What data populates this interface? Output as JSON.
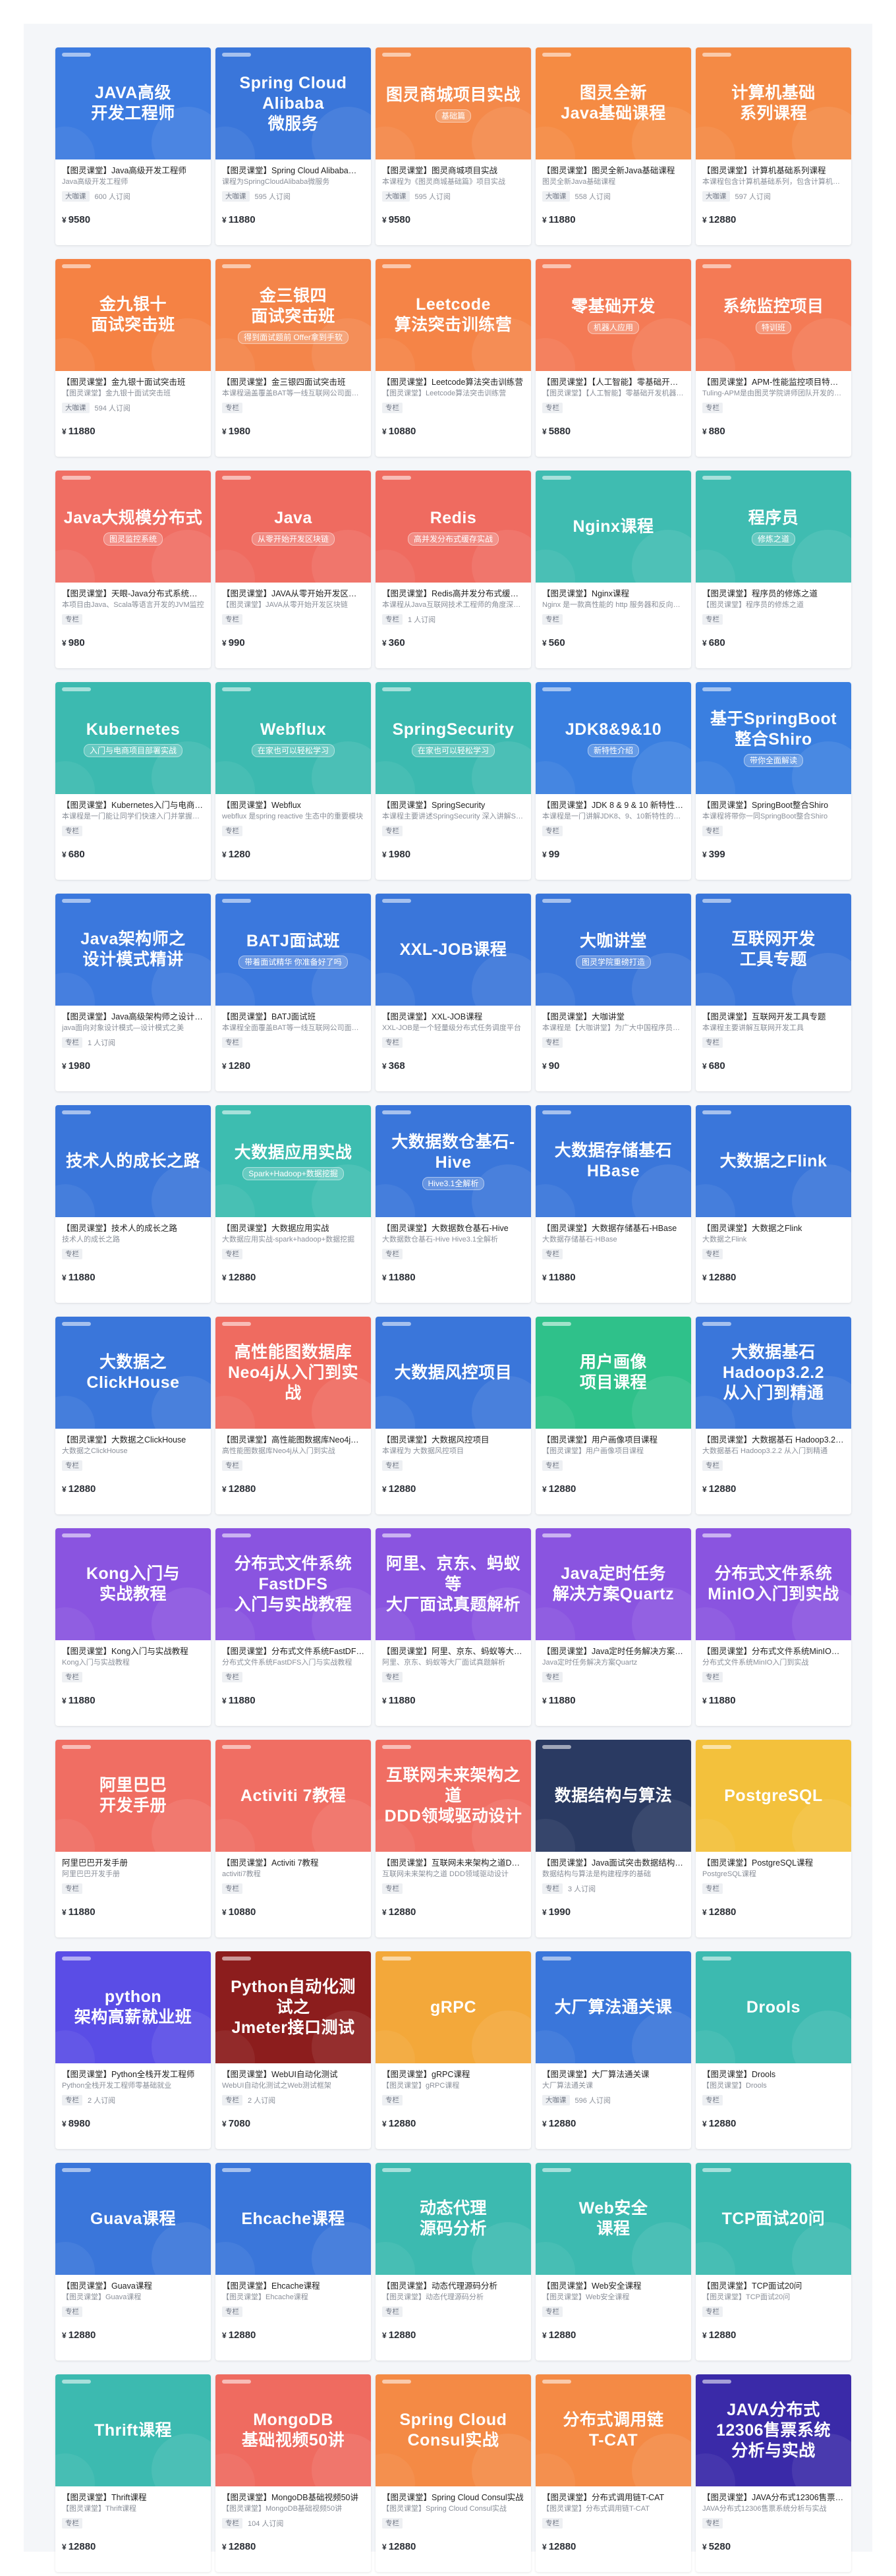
{
  "theme": {
    "price_color": "#2b2f36",
    "currency": "¥"
  },
  "courses": [
    {
      "cover_title": "JAVA高级\n开发工程师",
      "badge": "",
      "bg": "#3c7be0",
      "name": "【图灵课堂】Java高级开发工程师",
      "desc": "Java高级开发工程师",
      "tag": "大咖课",
      "enrolled": "600 人订阅",
      "price": "9580"
    },
    {
      "cover_title": "Spring Cloud Alibaba\n微服务",
      "badge": "",
      "bg": "#3a76da",
      "name": "【图灵课堂】Spring Cloud Alibaba微服务",
      "desc": "课程为SpringCloudAlibaba微服务",
      "tag": "大咖课",
      "enrolled": "595 人订阅",
      "price": "11880"
    },
    {
      "cover_title": "图灵商城项目实战",
      "badge": "基础篇",
      "bg": "#f4894a",
      "name": "【图灵课堂】图灵商城项目实战",
      "desc": "本课程为《图灵商城基础篇》项目实战",
      "tag": "大咖课",
      "enrolled": "595 人订阅",
      "price": "9580"
    },
    {
      "cover_title": "图灵全新\nJava基础课程",
      "badge": "",
      "bg": "#f58b43",
      "name": "【图灵课堂】图灵全新Java基础课程",
      "desc": "图灵全新Java基础课程",
      "tag": "大咖课",
      "enrolled": "558 人订阅",
      "price": "11880"
    },
    {
      "cover_title": "计算机基础\n系列课程",
      "badge": "",
      "bg": "#f48a45",
      "name": "【图灵课堂】计算机基础系列课程",
      "desc": "本课程包含计算机基础系列，包含计算机组成原理",
      "tag": "大咖课",
      "enrolled": "597 人订阅",
      "price": "12880"
    },
    {
      "cover_title": "金九银十\n面试突击班",
      "badge": "",
      "bg": "#f58244",
      "name": "【图灵课堂】金九银十面试突击班",
      "desc": "【图灵课堂】金九银十面试突击班",
      "tag": "大咖课",
      "enrolled": "594 人订阅",
      "price": "11880"
    },
    {
      "cover_title": "金三银四\n面试突击班",
      "badge": "得到面试题前 Offer拿到手软",
      "bg": "#f4854a",
      "name": "【图灵课堂】金三银四面试突击班",
      "desc": "本课程涵盖覆盖BAT等一线互联网公司面试题",
      "tag": "专栏",
      "enrolled": "",
      "price": "1980"
    },
    {
      "cover_title": "Leetcode\n算法突击训练营",
      "badge": "",
      "bg": "#f58447",
      "name": "【图灵课堂】Leetcode算法突击训练营",
      "desc": "【图灵课堂】Leetcode算法突击训练营",
      "tag": "专栏",
      "enrolled": "",
      "price": "10880"
    },
    {
      "cover_title": "零基础开发",
      "badge": "机器人应用",
      "bg": "#f47a55",
      "name": "【图灵课堂】【人工智能】零基础开发机器人应用",
      "desc": "【图灵课堂】【人工智能】零基础开发机器人应用",
      "tag": "专栏",
      "enrolled": "",
      "price": "5880"
    },
    {
      "cover_title": "系统监控项目",
      "badge": "特训班",
      "bg": "#f47a55",
      "name": "【图灵课堂】APM-性能监控项目特训班",
      "desc": "Tuling-APM是由图灵学院讲师团队开发的项目",
      "tag": "专栏",
      "enrolled": "",
      "price": "880"
    },
    {
      "cover_title": "Java大规模分布式",
      "badge": "图灵监控系统",
      "bg": "#f06e63",
      "name": "【图灵课堂】天眼-Java分布式系统监控",
      "desc": "本项目由Java、Scala等语言开发的JVM监控",
      "tag": "专栏",
      "enrolled": "",
      "price": "980"
    },
    {
      "cover_title": "Java",
      "badge": "从零开始开发区块链",
      "bg": "#ef6b60",
      "name": "【图灵课堂】JAVA从零开始开发区块链",
      "desc": "【图灵课堂】JAVA从零开始开发区块链",
      "tag": "专栏",
      "enrolled": "",
      "price": "990"
    },
    {
      "cover_title": "Redis",
      "badge": "高并发分布式缓存实战",
      "bg": "#ef6b60",
      "name": "【图灵课堂】Redis高并发分布式缓存实战",
      "desc": "本课程从Java互联网技术工程师的角度深入讲解",
      "tag": "专栏",
      "enrolled": "1 人订阅",
      "price": "360"
    },
    {
      "cover_title": "Nginx课程",
      "badge": "",
      "bg": "#3fbcb1",
      "name": "【图灵课堂】Nginx课程",
      "desc": "Nginx 是一款高性能的 http 服务器和反向代理",
      "tag": "专栏",
      "enrolled": "",
      "price": "560"
    },
    {
      "cover_title": "程序员",
      "badge": "修炼之道",
      "bg": "#3fbcb1",
      "name": "【图灵课堂】程序员的修炼之道",
      "desc": "【图灵课堂】程序员的修炼之道",
      "tag": "专栏",
      "enrolled": "",
      "price": "680"
    },
    {
      "cover_title": "Kubernetes",
      "badge": "入门与电商项目部署实战",
      "bg": "#3cbab0",
      "name": "【图灵课堂】Kubernetes入门与电商项目部署实战",
      "desc": "本课程是一门能让同学们快速入门并掌握的K8s",
      "tag": "专栏",
      "enrolled": "",
      "price": "680"
    },
    {
      "cover_title": "Webflux",
      "badge": "在家也可以轻松学习",
      "bg": "#3cbab0",
      "name": "【图灵课堂】Webflux",
      "desc": "webflux 是spring reactive 生态中的重要模块",
      "tag": "专栏",
      "enrolled": "",
      "price": "1280"
    },
    {
      "cover_title": "SpringSecurity",
      "badge": "在家也可以轻松学习",
      "bg": "#3cbab0",
      "name": "【图灵课堂】SpringSecurity",
      "desc": "本课程主要讲述SpringSecurity 深入讲解Spring",
      "tag": "专栏",
      "enrolled": "",
      "price": "1980"
    },
    {
      "cover_title": "JDK8&9&10",
      "badge": "新特性介绍",
      "bg": "#3a7fe0",
      "name": "【图灵课堂】JDK 8 & 9 & 10 新特性介绍",
      "desc": "本课程是一门讲解JDK8、9、10新特性的课程",
      "tag": "专栏",
      "enrolled": "",
      "price": "99"
    },
    {
      "cover_title": "基于SpringBoot\n整合Shiro",
      "badge": "带你全面解读",
      "bg": "#3a7fe0",
      "name": "【图灵课堂】SpringBoot整合Shiro",
      "desc": "本课程将带你一同SpringBoot整合Shiro",
      "tag": "专栏",
      "enrolled": "",
      "price": "399"
    },
    {
      "cover_title": "Java架构师之\n设计模式精讲",
      "badge": "",
      "bg": "#3b78dd",
      "name": "【图灵课堂】Java高级架构师之设计模式精讲",
      "desc": "java面向对象设计模式—设计模式之美",
      "tag": "专栏",
      "enrolled": "1 人订阅",
      "price": "1980"
    },
    {
      "cover_title": "BATJ面试班",
      "badge": "带着面试精华 你准备好了吗",
      "bg": "#3b78dd",
      "name": "【图灵课堂】BATJ面试班",
      "desc": "本课程全面覆盖BAT等一线互联网公司面试题",
      "tag": "专栏",
      "enrolled": "",
      "price": "1280"
    },
    {
      "cover_title": "XXL-JOB课程",
      "badge": "",
      "bg": "#3a76da",
      "name": "【图灵课堂】XXL-JOB课程",
      "desc": "XXL-JOB是一个轻量级分布式任务调度平台",
      "tag": "专栏",
      "enrolled": "",
      "price": "368"
    },
    {
      "cover_title": "大咖讲堂",
      "badge": "图灵学院重磅打造",
      "bg": "#3a76da",
      "name": "【图灵课堂】大咖讲堂",
      "desc": "本课程是【大咖讲堂】为广大中国程序员打造",
      "tag": "专栏",
      "enrolled": "",
      "price": "90"
    },
    {
      "cover_title": "互联网开发\n工具专题",
      "badge": "",
      "bg": "#3a76da",
      "name": "【图灵课堂】互联网开发工具专题",
      "desc": "本课程主要讲解互联网开发工具",
      "tag": "专栏",
      "enrolled": "",
      "price": "680"
    },
    {
      "cover_title": "技术人的成长之路",
      "badge": "",
      "bg": "#3a76da",
      "name": "【图灵课堂】技术人的成长之路",
      "desc": "技术人的成长之路",
      "tag": "专栏",
      "enrolled": "",
      "price": "11880"
    },
    {
      "cover_title": "大数据应用实战",
      "badge": "Spark+Hadoop+数据挖掘",
      "bg": "#3dbdb0",
      "name": "【图灵课堂】大数据应用实战",
      "desc": "大数据应用实战-spark+hadoop+数据挖掘",
      "tag": "专栏",
      "enrolled": "",
      "price": "12880"
    },
    {
      "cover_title": "大数据数仓基石-Hive",
      "badge": "Hive3.1全解析",
      "bg": "#3a76da",
      "name": "【图灵课堂】大数据数仓基石-Hive",
      "desc": "大数据数仓基石-Hive Hive3.1全解析",
      "tag": "专栏",
      "enrolled": "",
      "price": "11880"
    },
    {
      "cover_title": "大数据存储基石\nHBase",
      "badge": "",
      "bg": "#3a76da",
      "name": "【图灵课堂】大数据存储基石-HBase",
      "desc": "大数据存储基石-HBase",
      "tag": "专栏",
      "enrolled": "",
      "price": "11880"
    },
    {
      "cover_title": "大数据之Flink",
      "badge": "",
      "bg": "#3a76da",
      "name": "【图灵课堂】大数据之Flink",
      "desc": "大数据之Flink",
      "tag": "专栏",
      "enrolled": "",
      "price": "12880"
    },
    {
      "cover_title": "大数据之\nClickHouse",
      "badge": "",
      "bg": "#3a76da",
      "name": "【图灵课堂】大数据之ClickHouse",
      "desc": "大数据之ClickHouse",
      "tag": "专栏",
      "enrolled": "",
      "price": "12880"
    },
    {
      "cover_title": "高性能图数据库\nNeo4j从入门到实战",
      "badge": "",
      "bg": "#ef6b60",
      "name": "【图灵课堂】高性能图数据库Neo4j从入门到实战",
      "desc": "高性能图数据库Neo4j从入门到实战",
      "tag": "专栏",
      "enrolled": "",
      "price": "12880"
    },
    {
      "cover_title": "大数据风控项目",
      "badge": "",
      "bg": "#3a76da",
      "name": "【图灵课堂】大数据风控项目",
      "desc": "本课程为 大数据风控项目",
      "tag": "专栏",
      "enrolled": "",
      "price": "12880"
    },
    {
      "cover_title": "用户画像\n项目课程",
      "badge": "",
      "bg": "#2fc18a",
      "name": "【图灵课堂】用户画像项目课程",
      "desc": "【图灵课堂】用户画像项目课程",
      "tag": "专栏",
      "enrolled": "",
      "price": "12880"
    },
    {
      "cover_title": "大数据基石 Hadoop3.2.2\n从入门到精通",
      "badge": "",
      "bg": "#3a76da",
      "name": "【图灵课堂】大数据基石 Hadoop3.2.2 从入门到精通",
      "desc": "大数据基石 Hadoop3.2.2 从入门到精通",
      "tag": "专栏",
      "enrolled": "",
      "price": "12880"
    },
    {
      "cover_title": "Kong入门与\n实战教程",
      "badge": "",
      "bg": "#8a54e0",
      "name": "【图灵课堂】Kong入门与实战教程",
      "desc": "Kong入门与实战教程",
      "tag": "专栏",
      "enrolled": "",
      "price": "11880"
    },
    {
      "cover_title": "分布式文件系统FastDFS\n入门与实战教程",
      "badge": "",
      "bg": "#8a54e0",
      "name": "【图灵课堂】分布式文件系统FastDFS入门与实战教程",
      "desc": "分布式文件系统FastDFS入门与实战教程",
      "tag": "专栏",
      "enrolled": "",
      "price": "11880"
    },
    {
      "cover_title": "阿里、京东、蚂蚁等\n大厂面试真题解析",
      "badge": "",
      "bg": "#8a54e0",
      "name": "【图灵课堂】阿里、京东、蚂蚁等大厂面试真题解析",
      "desc": "阿里、京东、蚂蚁等大厂面试真题解析",
      "tag": "专栏",
      "enrolled": "",
      "price": "11880"
    },
    {
      "cover_title": "Java定时任务\n解决方案Quartz",
      "badge": "",
      "bg": "#8a54e0",
      "name": "【图灵课堂】Java定时任务解决方案Quartz",
      "desc": "Java定时任务解决方案Quartz",
      "tag": "专栏",
      "enrolled": "",
      "price": "11880"
    },
    {
      "cover_title": "分布式文件系统\nMinIO入门到实战",
      "badge": "",
      "bg": "#8a54e0",
      "name": "【图灵课堂】分布式文件系统MinIO入门到实战",
      "desc": "分布式文件系统MinIO入门到实战",
      "tag": "专栏",
      "enrolled": "",
      "price": "11880"
    },
    {
      "cover_title": "阿里巴巴\n开发手册",
      "badge": "",
      "bg": "#f06e63",
      "name": "阿里巴巴开发手册",
      "desc": "阿里巴巴开发手册",
      "tag": "专栏",
      "enrolled": "",
      "price": "11880"
    },
    {
      "cover_title": "Activiti 7教程",
      "badge": "",
      "bg": "#f06e63",
      "name": "【图灵课堂】Activiti 7教程",
      "desc": "activiti7教程",
      "tag": "专栏",
      "enrolled": "",
      "price": "10880"
    },
    {
      "cover_title": "互联网未来架构之道\nDDD领域驱动设计",
      "badge": "",
      "bg": "#f06e63",
      "name": "【图灵课堂】互联网未来架构之道DDD领域驱动设计",
      "desc": "互联网未来架构之道 DDD领域驱动设计",
      "tag": "专栏",
      "enrolled": "",
      "price": "12880"
    },
    {
      "cover_title": "数据结构与算法",
      "badge": "",
      "bg": "#2a3a62",
      "name": "【图灵课堂】Java面试突击数据结构与算法",
      "desc": "数据结构与算法是构建程序的基础",
      "tag": "专栏",
      "enrolled": "3 人订阅",
      "price": "1990"
    },
    {
      "cover_title": "PostgreSQL",
      "badge": "",
      "bg": "#f3c13c",
      "name": "【图灵课堂】PostgreSQL课程",
      "desc": "PostgreSQL课程",
      "tag": "专栏",
      "enrolled": "",
      "price": "12880"
    },
    {
      "cover_title": "python\n架构高薪就业班",
      "badge": "",
      "bg": "#5a4de6",
      "name": "【图灵课堂】Python全栈开发工程师",
      "desc": "Python全栈开发工程师零基础就业",
      "tag": "专栏",
      "enrolled": "2 人订阅",
      "price": "8980"
    },
    {
      "cover_title": "Python自动化测试之\nJmeter接口测试",
      "badge": "",
      "bg": "#8c1d1d",
      "name": "【图灵课堂】WebUI自动化测试",
      "desc": "WebUI自动化测试之Web测试框架",
      "tag": "专栏",
      "enrolled": "2 人订阅",
      "price": "7080"
    },
    {
      "cover_title": "gRPC",
      "badge": "",
      "bg": "#f3a83a",
      "name": "【图灵课堂】gRPC课程",
      "desc": "【图灵课堂】gRPC课程",
      "tag": "专栏",
      "enrolled": "",
      "price": "12880"
    },
    {
      "cover_title": "大厂算法通关课",
      "badge": "",
      "bg": "#3a76da",
      "name": "【图灵课堂】大厂算法通关课",
      "desc": "大厂算法通关课",
      "tag": "大咖课",
      "enrolled": "596 人订阅",
      "price": "12880"
    },
    {
      "cover_title": "Drools",
      "badge": "",
      "bg": "#3cbab0",
      "name": "【图灵课堂】Drools",
      "desc": "【图灵课堂】Drools",
      "tag": "专栏",
      "enrolled": "",
      "price": "12880"
    },
    {
      "cover_title": "Guava课程",
      "badge": "",
      "bg": "#3a76da",
      "name": "【图灵课堂】Guava课程",
      "desc": "【图灵课堂】Guava课程",
      "tag": "专栏",
      "enrolled": "",
      "price": "12880"
    },
    {
      "cover_title": "Ehcache课程",
      "badge": "",
      "bg": "#3a76da",
      "name": "【图灵课堂】Ehcache课程",
      "desc": "【图灵课堂】Ehcache课程",
      "tag": "专栏",
      "enrolled": "",
      "price": "12880"
    },
    {
      "cover_title": "动态代理\n源码分析",
      "badge": "",
      "bg": "#3cbab0",
      "name": "【图灵课堂】动态代理源码分析",
      "desc": "【图灵课堂】动态代理源码分析",
      "tag": "专栏",
      "enrolled": "",
      "price": "12880"
    },
    {
      "cover_title": "Web安全\n课程",
      "badge": "",
      "bg": "#3cbab0",
      "name": "【图灵课堂】Web安全课程",
      "desc": "【图灵课堂】Web安全课程",
      "tag": "专栏",
      "enrolled": "",
      "price": "12880"
    },
    {
      "cover_title": "TCP面试20问",
      "badge": "",
      "bg": "#3cbab0",
      "name": "【图灵课堂】TCP面试20问",
      "desc": "【图灵课堂】TCP面试20问",
      "tag": "专栏",
      "enrolled": "",
      "price": "12880"
    },
    {
      "cover_title": "Thrift课程",
      "badge": "",
      "bg": "#3cbab0",
      "name": "【图灵课堂】Thrift课程",
      "desc": "【图灵课堂】Thrift课程",
      "tag": "专栏",
      "enrolled": "",
      "price": "12880"
    },
    {
      "cover_title": "MongoDB\n基础视频50讲",
      "badge": "",
      "bg": "#ef6b60",
      "name": "【图灵课堂】MongoDB基础视频50讲",
      "desc": "【图灵课堂】MongoDB基础视频50讲",
      "tag": "专栏",
      "enrolled": "104 人订阅",
      "price": "12880"
    },
    {
      "cover_title": "Spring Cloud\nConsul实战",
      "badge": "",
      "bg": "#f48a45",
      "name": "【图灵课堂】Spring Cloud Consul实战",
      "desc": "【图灵课堂】Spring Cloud Consul实战",
      "tag": "专栏",
      "enrolled": "",
      "price": "12880"
    },
    {
      "cover_title": "分布式调用链\nT-CAT",
      "badge": "",
      "bg": "#f48a45",
      "name": "【图灵课堂】分布式调用链T-CAT",
      "desc": "【图灵课堂】分布式调用链T-CAT",
      "tag": "专栏",
      "enrolled": "",
      "price": "12880"
    },
    {
      "cover_title": "JAVA分布式\n12306售票系统\n分析与实战",
      "badge": "",
      "bg": "#3a2aa8",
      "name": "【图灵课堂】JAVA分布式12306售票系统分析与实战",
      "desc": "JAVA分布式12306售票系统分析与实战",
      "tag": "专栏",
      "enrolled": "",
      "price": "5280"
    }
  ]
}
